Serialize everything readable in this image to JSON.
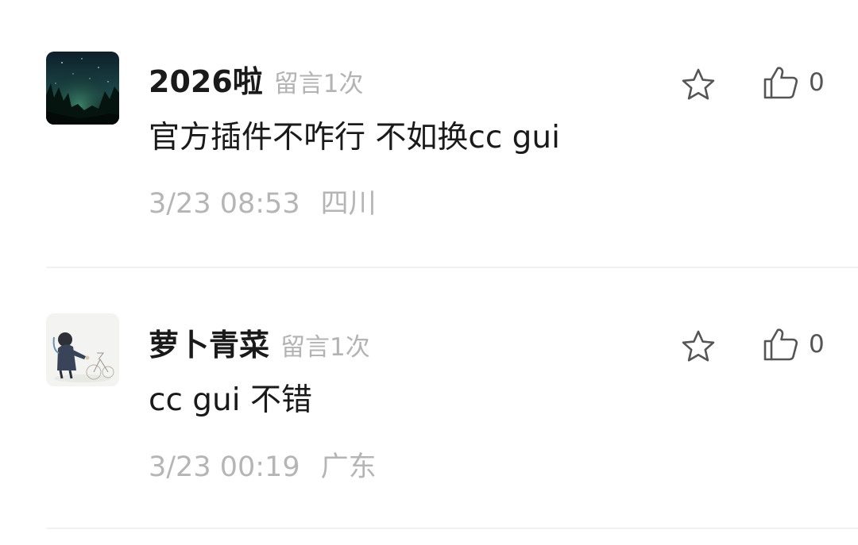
{
  "comments": [
    {
      "username": "2026啦",
      "message_count": "留言1次",
      "content": "官方插件不咋行 不如换cc gui",
      "time": "3/23 08:53",
      "region": "四川",
      "likes": "0",
      "avatar_icon": "night-forest-avatar",
      "star_icon": "star-outline-icon",
      "like_icon": "thumbs-up-outline-icon"
    },
    {
      "username": "萝卜青菜",
      "message_count": "留言1次",
      "content": "cc gui 不错",
      "time": "3/23 00:19",
      "region": "广东",
      "likes": "0",
      "avatar_icon": "girl-with-bicycle-avatar",
      "star_icon": "star-outline-icon",
      "like_icon": "thumbs-up-outline-icon"
    }
  ],
  "colors": {
    "text_primary": "#1a1a1a",
    "text_secondary": "#b3b3b3",
    "divider": "#f1f1f1",
    "icon": "#555555"
  }
}
